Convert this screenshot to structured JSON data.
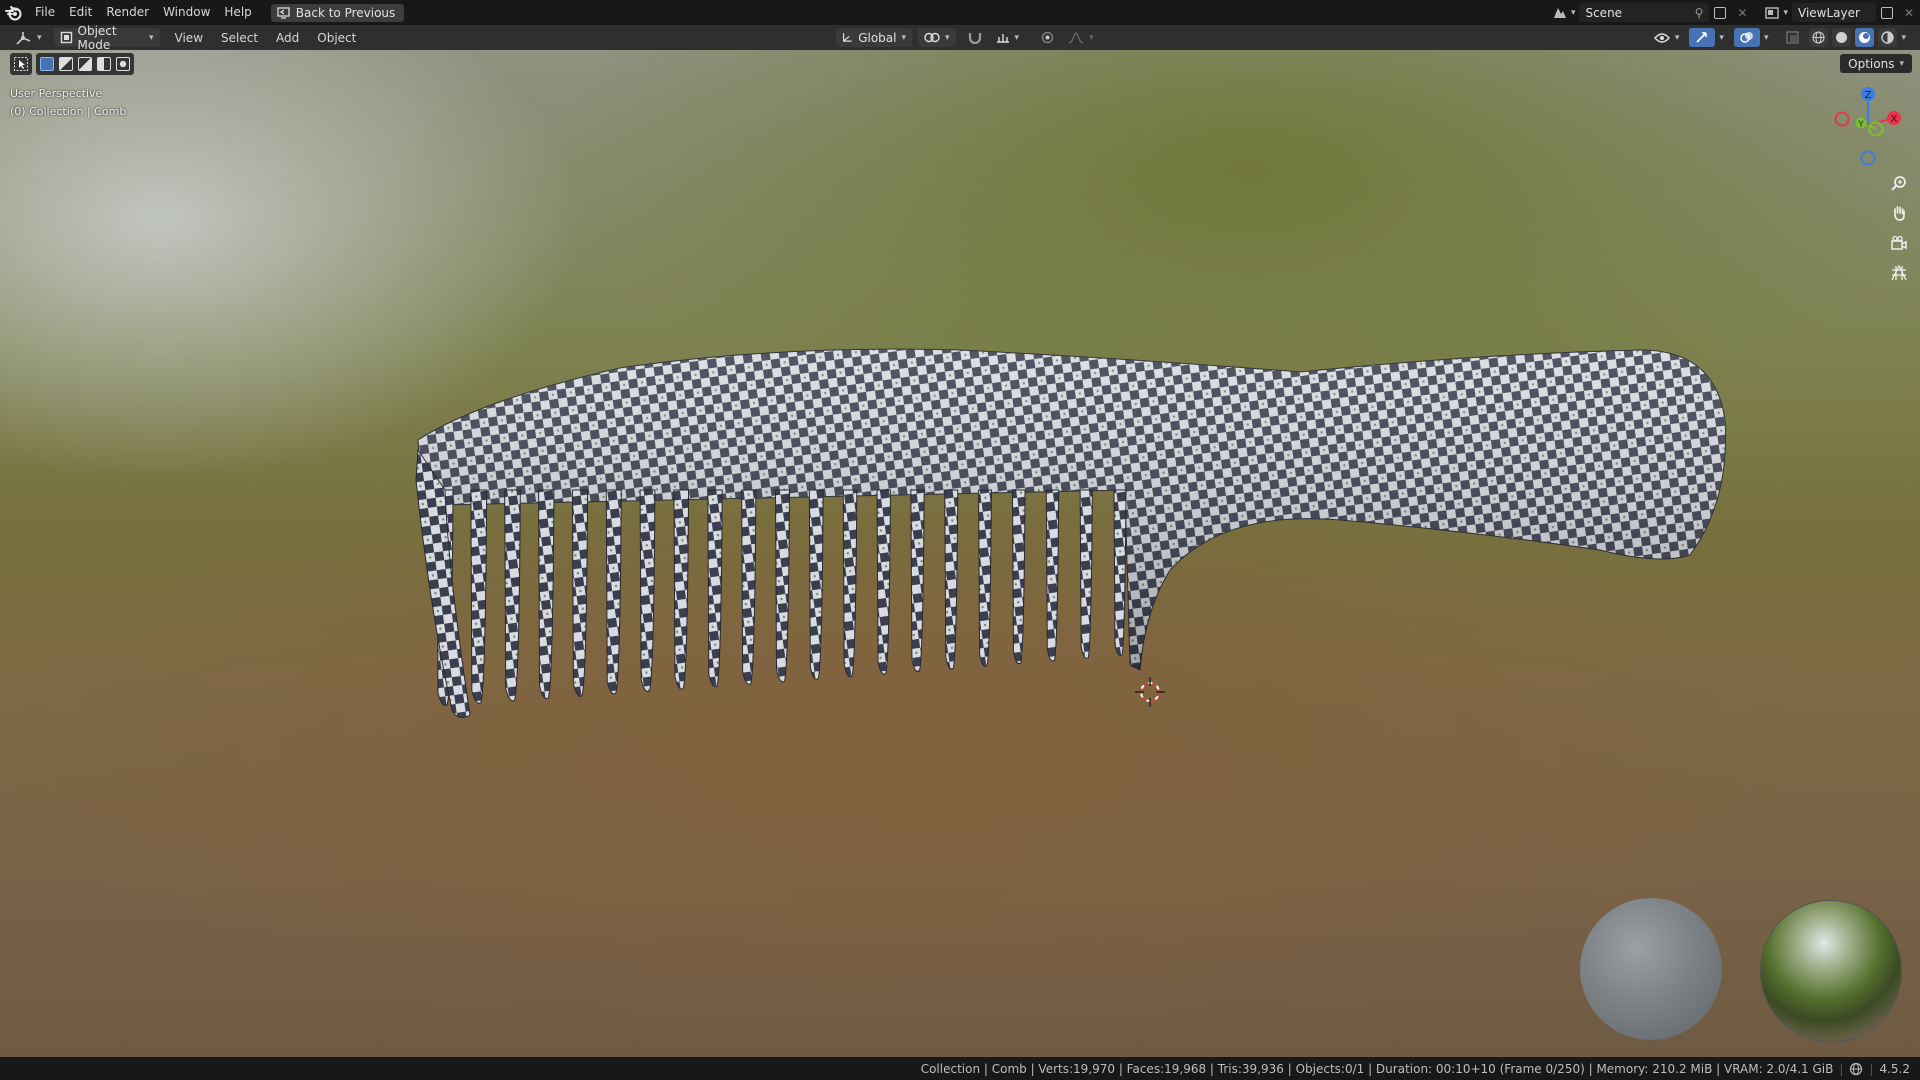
{
  "topbar": {
    "menus": [
      "File",
      "Edit",
      "Render",
      "Window",
      "Help"
    ],
    "back_button": "Back to Previous",
    "scene_name": "Scene",
    "view_layer_name": "ViewLayer"
  },
  "header": {
    "mode": "Object Mode",
    "menus": [
      "View",
      "Select",
      "Add",
      "Object"
    ],
    "transform_orientation": "Global"
  },
  "viewport": {
    "perspective_label": "User Perspective",
    "collection_label": "(0) Collection | Comb",
    "options_label": "Options",
    "gizmo_axes": {
      "z": "Z",
      "y": "Y",
      "x": "X"
    },
    "nav_icons": [
      "zoom-icon",
      "hand-pan-icon",
      "camera-icon",
      "grid-ortho-icon"
    ]
  },
  "statusbar": {
    "info": "Collection | Comb | Verts:19,970 | Faces:19,968 | Tris:39,936 | Objects:0/1 | Duration: 00:10+10 (Frame 0/250) | Memory: 210.2 MiB | VRAM: 2.0/4.1 GiB",
    "version": "4.5.2"
  },
  "colors": {
    "accent": "#4772b3",
    "axis_x": "#e8334d",
    "axis_y": "#7bc12a",
    "axis_z": "#3b7ee0"
  }
}
